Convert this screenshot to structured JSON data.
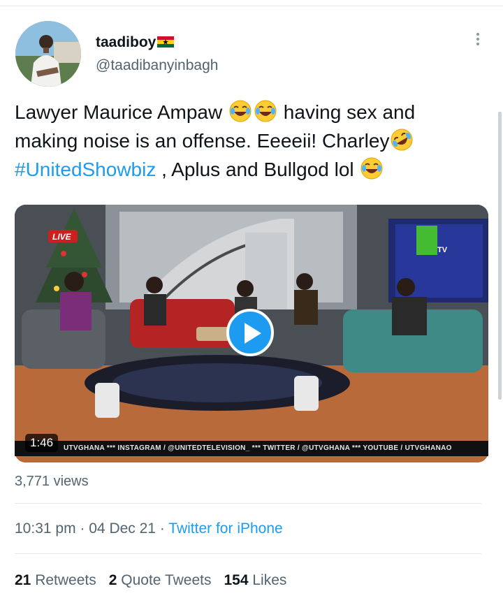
{
  "author": {
    "display_name": "taadiboy",
    "handle": "@taadibanyinbagh",
    "flag_icon": "ghana-flag-icon"
  },
  "tweet": {
    "line1_a": "Lawyer Maurice Ampaw",
    "line1_b": "having sex and",
    "line2_a": "making noise is an offense. Eeeeii! Charley",
    "hashtag": "#UnitedShowbiz",
    "line3_b": ", Aplus and Bullgod lol",
    "emojis": [
      "joy-emoji",
      "joy-emoji",
      "rofl-emoji",
      "joy-emoji"
    ]
  },
  "video": {
    "duration": "1:46",
    "live_badge": "LIVE",
    "channel_logo": "TV",
    "ticker": "UTVGHANA  ***  INSTAGRAM / @UNITEDTELEVISION_  ***  TWITTER / @UTVGHANA  ***  YOUTUBE / UTVGHANAO"
  },
  "views": "3,771 views",
  "meta": {
    "time": "10:31 pm",
    "dot": "·",
    "date": "04 Dec 21",
    "source": "Twitter for iPhone"
  },
  "stats": {
    "retweets_count": "21",
    "retweets_label": "Retweets",
    "quotes_count": "2",
    "quotes_label": "Quote Tweets",
    "likes_count": "154",
    "likes_label": "Likes"
  },
  "colors": {
    "accent": "#1d9bf0",
    "text": "#0f1419",
    "muted": "#536471"
  }
}
